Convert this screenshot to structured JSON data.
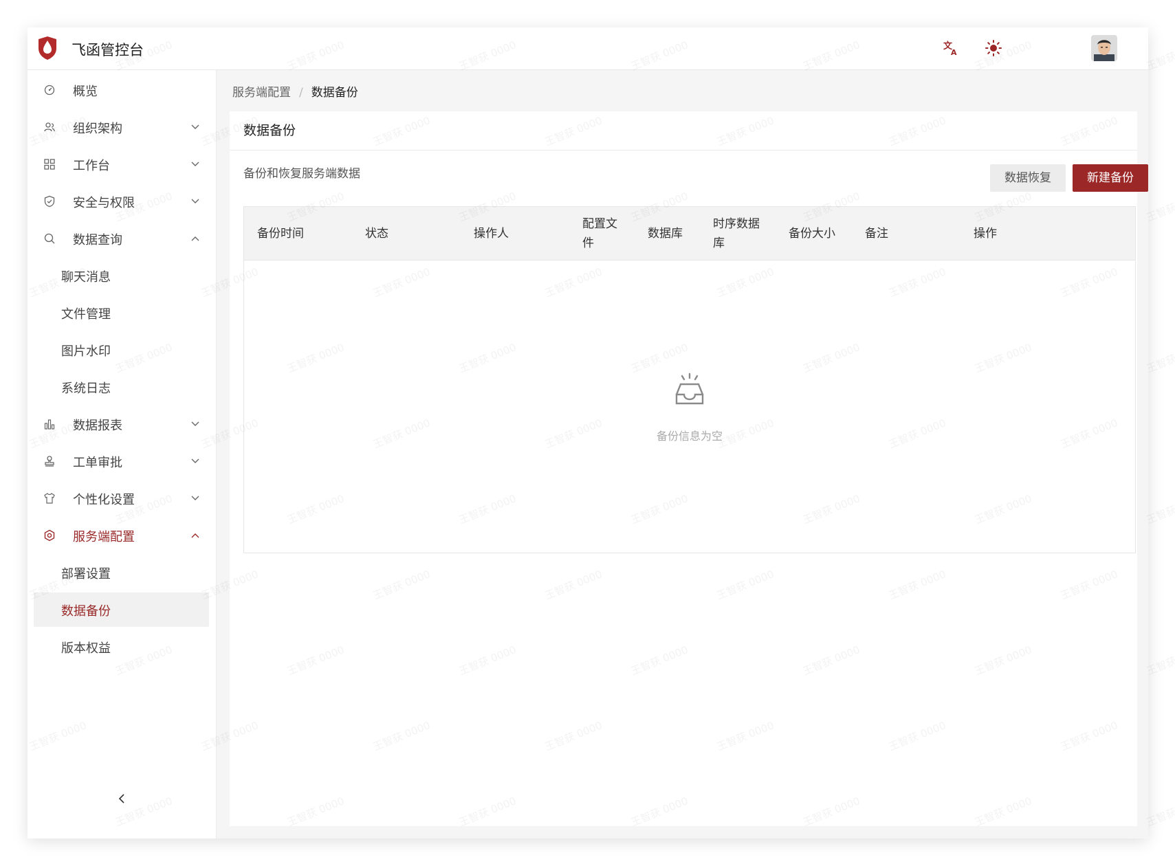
{
  "app": {
    "title": "飞函管控台",
    "brand_color": "#9b2727"
  },
  "header": {
    "icons": [
      "translate-icon",
      "sun-icon"
    ]
  },
  "sidebar": {
    "items": [
      {
        "label": "概览",
        "icon": "dashboard-icon",
        "expandable": false
      },
      {
        "label": "组织架构",
        "icon": "org-icon",
        "expandable": true,
        "expanded": false
      },
      {
        "label": "工作台",
        "icon": "grid-icon",
        "expandable": true,
        "expanded": false
      },
      {
        "label": "安全与权限",
        "icon": "shield-icon",
        "expandable": true,
        "expanded": false
      },
      {
        "label": "数据查询",
        "icon": "search-icon",
        "expandable": true,
        "expanded": true
      },
      {
        "label": "聊天消息",
        "sub": true
      },
      {
        "label": "文件管理",
        "sub": true
      },
      {
        "label": "图片水印",
        "sub": true
      },
      {
        "label": "系统日志",
        "sub": true
      },
      {
        "label": "数据报表",
        "icon": "bar-chart-icon",
        "expandable": true,
        "expanded": false
      },
      {
        "label": "工单审批",
        "icon": "stamp-icon",
        "expandable": true,
        "expanded": false
      },
      {
        "label": "个性化设置",
        "icon": "shirt-icon",
        "expandable": true,
        "expanded": false
      },
      {
        "label": "服务端配置",
        "icon": "settings-icon",
        "expandable": true,
        "expanded": true,
        "active": true
      },
      {
        "label": "部署设置",
        "sub": true
      },
      {
        "label": "数据备份",
        "sub": true,
        "selected": true
      },
      {
        "label": "版本权益",
        "sub": true
      }
    ]
  },
  "breadcrumb": {
    "parent": "服务端配置",
    "separator": "/",
    "current": "数据备份"
  },
  "card": {
    "title": "数据备份",
    "description": "备份和恢复服务端数据",
    "restore_label": "数据恢复",
    "new_label": "新建备份"
  },
  "table": {
    "columns": [
      "备份时间",
      "状态",
      "操作人",
      "配置文件",
      "数据库",
      "时序数据库",
      "备份大小",
      "备注",
      "操作"
    ],
    "rows": [],
    "empty_text": "备份信息为空"
  },
  "watermark": {
    "text": "王智获 0000"
  }
}
